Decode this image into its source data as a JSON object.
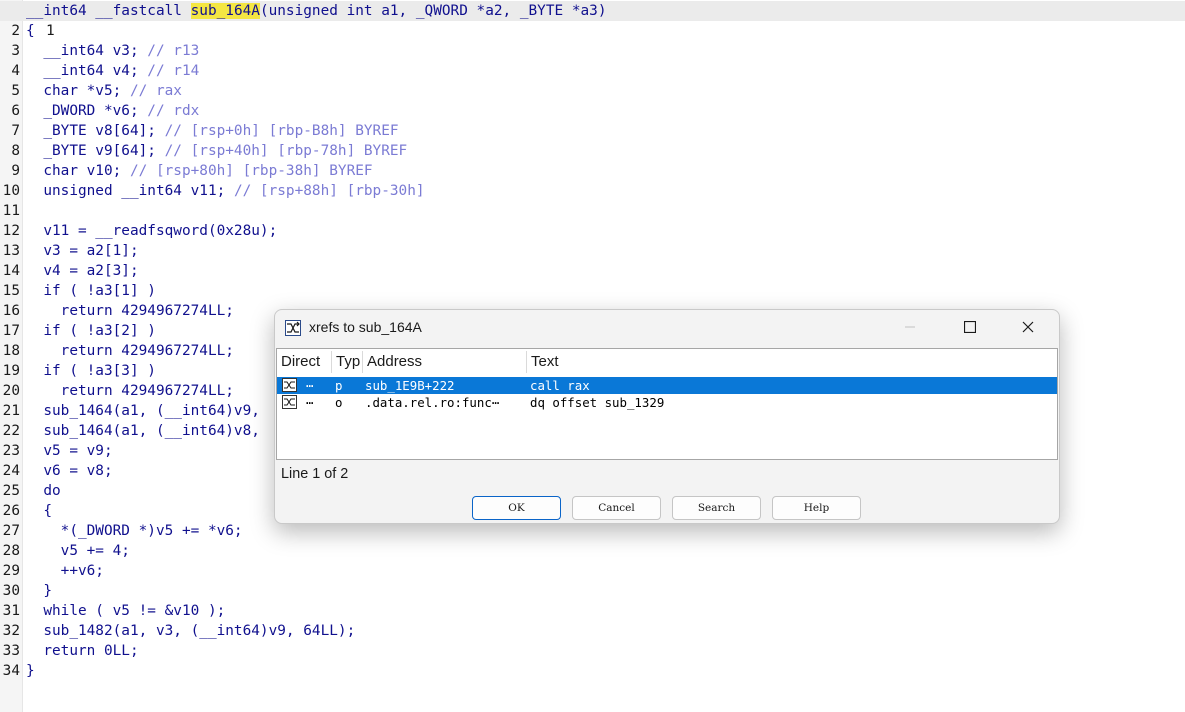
{
  "code": {
    "lines": [
      {
        "n": "1",
        "t": ""
      },
      {
        "n": "2",
        "t": "{"
      },
      {
        "n": "3",
        "t": "  __int64 v3; // r13"
      },
      {
        "n": "4",
        "t": "  __int64 v4; // r14"
      },
      {
        "n": "5",
        "t": "  char *v5; // rax"
      },
      {
        "n": "6",
        "t": "  _DWORD *v6; // rdx"
      },
      {
        "n": "7",
        "t": "  _BYTE v8[64]; // [rsp+0h] [rbp-B8h] BYREF"
      },
      {
        "n": "8",
        "t": "  _BYTE v9[64]; // [rsp+40h] [rbp-78h] BYREF"
      },
      {
        "n": "9",
        "t": "  char v10; // [rsp+80h] [rbp-38h] BYREF"
      },
      {
        "n": "10",
        "t": "  unsigned __int64 v11; // [rsp+88h] [rbp-30h]"
      },
      {
        "n": "11",
        "t": ""
      },
      {
        "n": "12",
        "t": "  v11 = __readfsqword(0x28u);"
      },
      {
        "n": "13",
        "t": "  v3 = a2[1];"
      },
      {
        "n": "14",
        "t": "  v4 = a2[3];"
      },
      {
        "n": "15",
        "t": "  if ( !a3[1] )"
      },
      {
        "n": "16",
        "t": "    return 4294967274LL;"
      },
      {
        "n": "17",
        "t": "  if ( !a3[2] )"
      },
      {
        "n": "18",
        "t": "    return 4294967274LL;"
      },
      {
        "n": "19",
        "t": "  if ( !a3[3] )"
      },
      {
        "n": "20",
        "t": "    return 4294967274LL;"
      },
      {
        "n": "21",
        "t": "  sub_1464(a1, (__int64)v9,"
      },
      {
        "n": "22",
        "t": "  sub_1464(a1, (__int64)v8,"
      },
      {
        "n": "23",
        "t": "  v5 = v9;"
      },
      {
        "n": "24",
        "t": "  v6 = v8;"
      },
      {
        "n": "25",
        "t": "  do"
      },
      {
        "n": "26",
        "t": "  {"
      },
      {
        "n": "27",
        "t": "    *(_DWORD *)v5 += *v6;"
      },
      {
        "n": "28",
        "t": "    v5 += 4;"
      },
      {
        "n": "29",
        "t": "    ++v6;"
      },
      {
        "n": "30",
        "t": "  }"
      },
      {
        "n": "31",
        "t": "  while ( v5 != &v10 );"
      },
      {
        "n": "32",
        "t": "  sub_1482(a1, v3, (__int64)v9, 64LL);"
      },
      {
        "n": "33",
        "t": "  return 0LL;"
      },
      {
        "n": "34",
        "t": "}"
      }
    ],
    "header_pre": "__int64 __fastcall ",
    "header_func": "sub_164A",
    "header_post": "(unsigned int a1, _QWORD *a2, _BYTE *a3)"
  },
  "dialog": {
    "title": "xrefs to sub_164A",
    "icon": "xref-icon",
    "columns": [
      "Direct",
      "Typ",
      "Address",
      "Text"
    ],
    "rows": [
      {
        "direction": "⋯",
        "type": "p",
        "address": "sub_1E9B+222",
        "text": "call    rax",
        "selected": true
      },
      {
        "direction": "⋯",
        "type": "o",
        "address": ".data.rel.ro:func⋯",
        "text": "dq offset sub_1329",
        "selected": false
      }
    ],
    "status": "Line 1 of 2",
    "buttons": {
      "ok": "OK",
      "cancel": "Cancel",
      "search": "Search",
      "help": "Help"
    },
    "colors": {
      "selection": "#0a78d7",
      "highlight": "#f4e642"
    }
  }
}
